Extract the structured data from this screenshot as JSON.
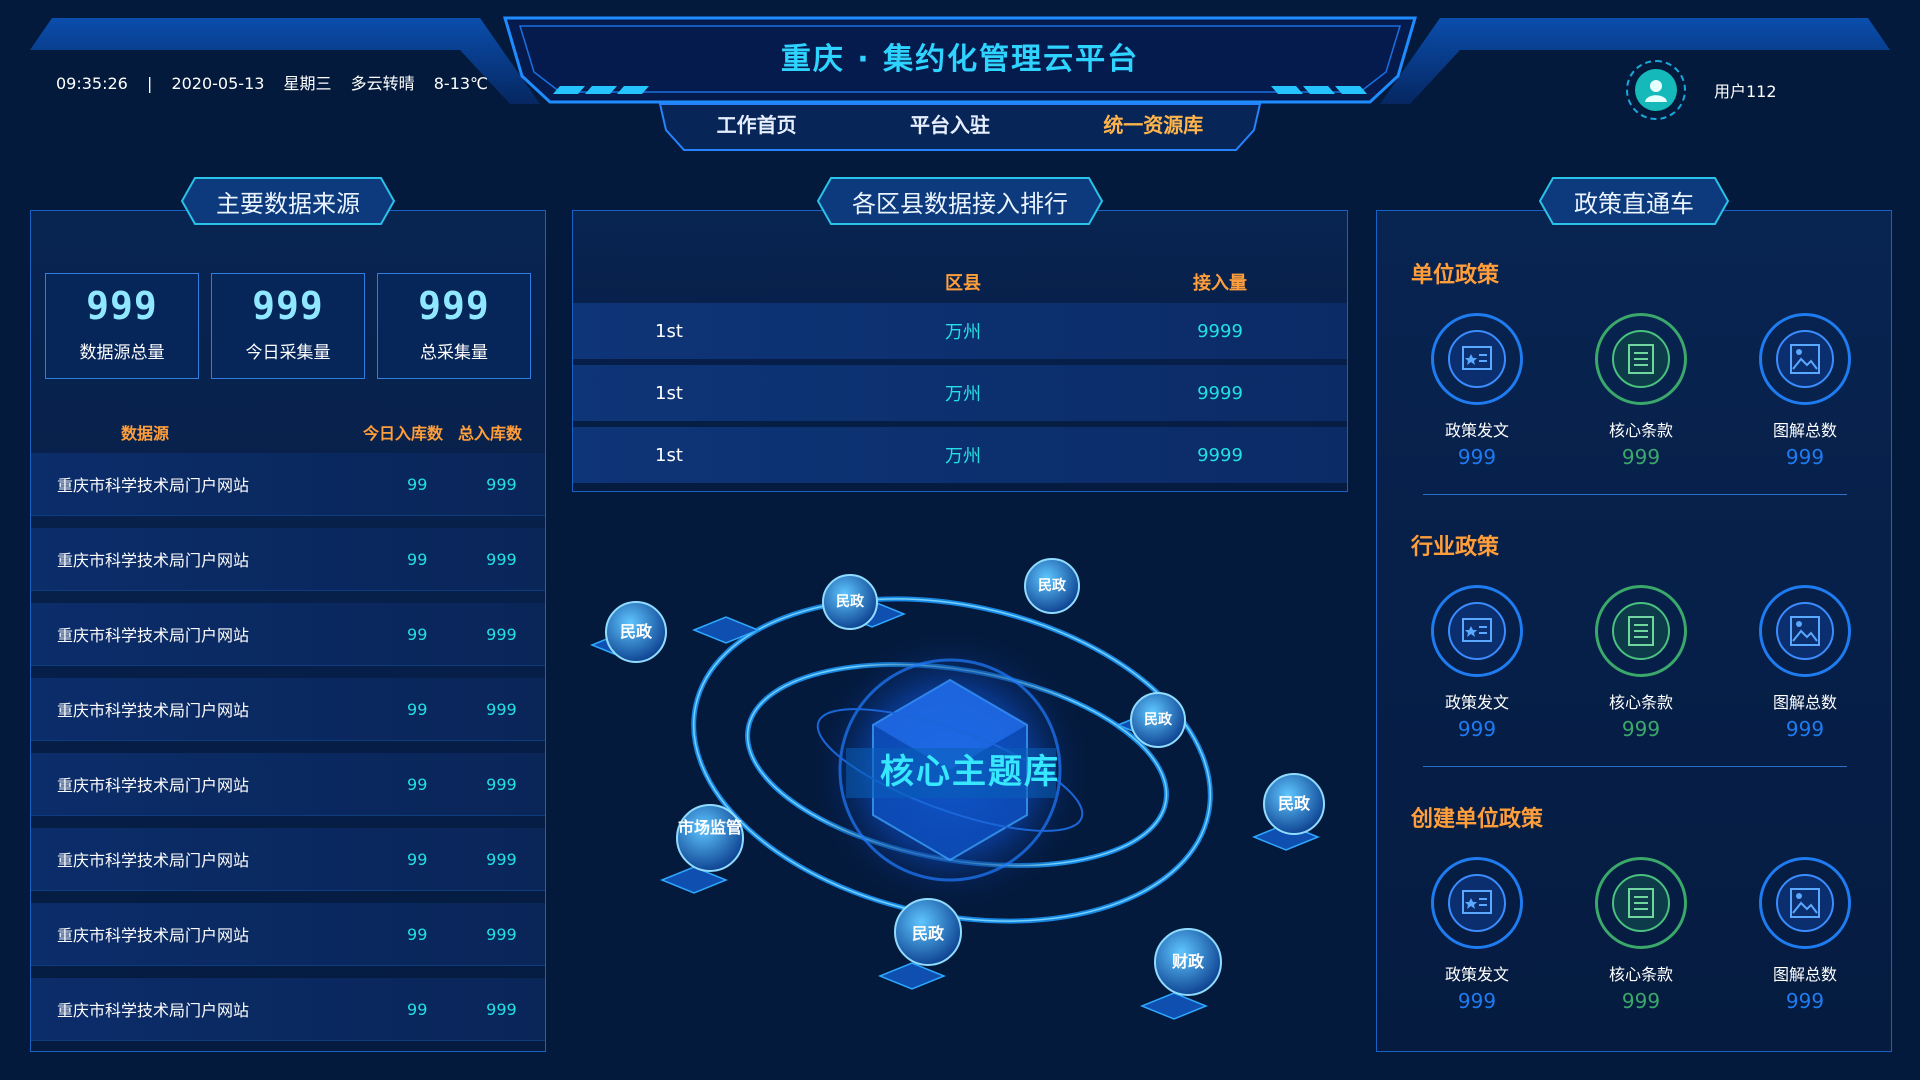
{
  "header": {
    "time": "09:35:26",
    "date": "2020-05-13",
    "weekday": "星期三",
    "weather": "多云转晴",
    "temp": "8-13℃",
    "title": "重庆 · 集约化管理云平台",
    "nav": [
      "工作首页",
      "平台入驻",
      "统一资源库"
    ],
    "active_nav": "统一资源库",
    "user": "用户112"
  },
  "left": {
    "title": "主要数据来源",
    "stats": [
      {
        "value": "999",
        "label": "数据源总量"
      },
      {
        "value": "999",
        "label": "今日采集量"
      },
      {
        "value": "999",
        "label": "总采集量"
      }
    ],
    "headers": {
      "name": "数据源",
      "today": "今日入库数",
      "total": "总入库数"
    },
    "rows": [
      {
        "name": "重庆市科学技术局门户网站",
        "today": "99",
        "total": "999"
      },
      {
        "name": "重庆市科学技术局门户网站",
        "today": "99",
        "total": "999"
      },
      {
        "name": "重庆市科学技术局门户网站",
        "today": "99",
        "total": "999"
      },
      {
        "name": "重庆市科学技术局门户网站",
        "today": "99",
        "total": "999"
      },
      {
        "name": "重庆市科学技术局门户网站",
        "today": "99",
        "total": "999"
      },
      {
        "name": "重庆市科学技术局门户网站",
        "today": "99",
        "total": "999"
      },
      {
        "name": "重庆市科学技术局门户网站",
        "today": "99",
        "total": "999"
      },
      {
        "name": "重庆市科学技术局门户网站",
        "today": "99",
        "total": "999"
      }
    ]
  },
  "center": {
    "title": "各区县数据接入排行",
    "headers": {
      "rank": "",
      "district": "区县",
      "amount": "接入量"
    },
    "rows": [
      {
        "rank": "1st",
        "district": "万州",
        "amount": "9999"
      },
      {
        "rank": "1st",
        "district": "万州",
        "amount": "9999"
      },
      {
        "rank": "1st",
        "district": "万州",
        "amount": "9999"
      }
    ],
    "core": "核心主题库",
    "nodes": [
      "民政",
      "民政",
      "民政",
      "民政",
      "民政",
      "市场监管",
      "民政",
      "财政"
    ]
  },
  "right": {
    "title": "政策直通车",
    "sections": [
      {
        "title": "单位政策",
        "items": [
          {
            "label": "政策发文",
            "value": "999"
          },
          {
            "label": "核心条款",
            "value": "999"
          },
          {
            "label": "图解总数",
            "value": "999"
          }
        ]
      },
      {
        "title": "行业政策",
        "items": [
          {
            "label": "政策发文",
            "value": "999"
          },
          {
            "label": "核心条款",
            "value": "999"
          },
          {
            "label": "图解总数",
            "value": "999"
          }
        ]
      },
      {
        "title": "创建单位政策",
        "items": [
          {
            "label": "政策发文",
            "value": "999"
          },
          {
            "label": "核心条款",
            "value": "999"
          },
          {
            "label": "图解总数",
            "value": "999"
          }
        ]
      }
    ]
  },
  "colors": {
    "background": "#041a3d",
    "accent": "#2fd3ff",
    "orange": "#ff9e3a",
    "cyan_value": "#22e0e4",
    "ring_blue": "#1e7bf0",
    "ring_green": "#3aa86a"
  },
  "icons": [
    "user-avatar-icon",
    "policy-document-icon",
    "core-clause-icon",
    "diagram-image-icon"
  ]
}
